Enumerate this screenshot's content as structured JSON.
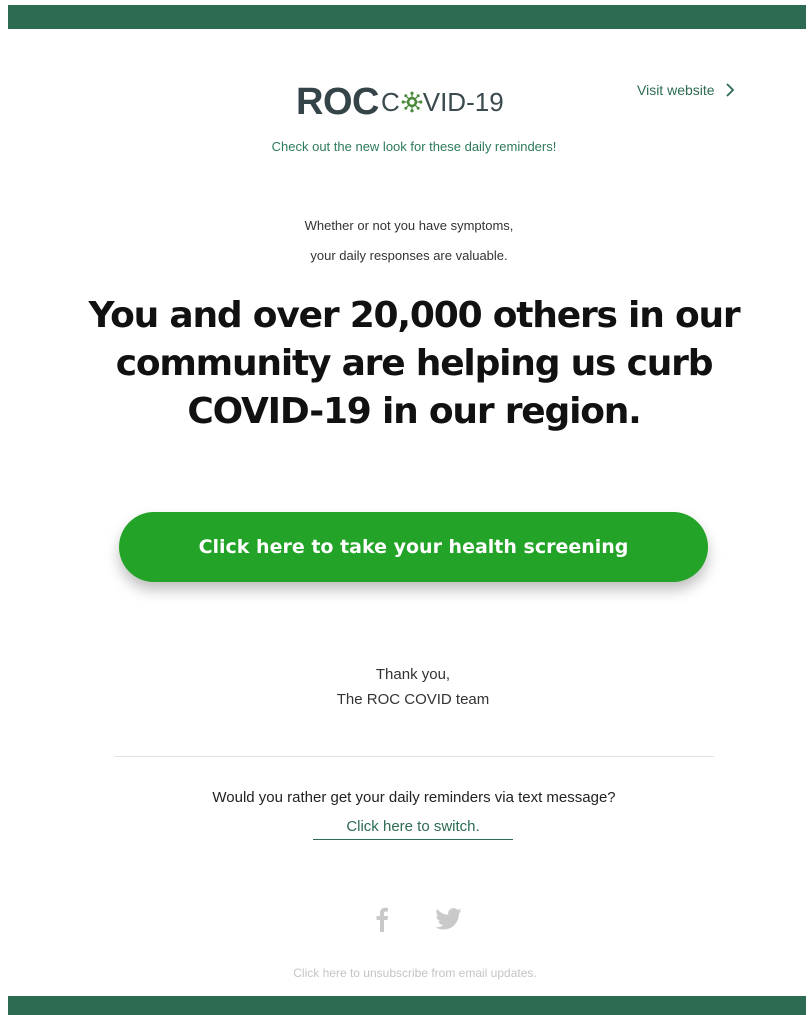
{
  "brand": {
    "logo_bold": "ROC",
    "logo_c": "C",
    "logo_rest": "VID-19",
    "colors": {
      "brand_green": "#2d6b52",
      "button_green": "#23a327",
      "link_green": "#2d7a5a",
      "logo_dark": "#344448"
    }
  },
  "header": {
    "visit_link_label": "Visit website",
    "tagline": "Check out the new look for these daily reminders!"
  },
  "body": {
    "intro_line1": "Whether or not you have symptoms,",
    "intro_line2": "your daily responses are valuable.",
    "headline": "You and over 20,000 others in our community are helping us curb COVID-19 in our region.",
    "cta_label": "Click here to take your health screening",
    "signoff_line1": "Thank you,",
    "signoff_line2": "The ROC COVID team"
  },
  "footer": {
    "sms_question": "Would you rather get your daily reminders via text message?",
    "sms_link": "Click here to switch.",
    "social_icons": [
      "facebook-icon",
      "twitter-icon"
    ],
    "unsubscribe": "Click here to unsubscribe from email updates."
  }
}
